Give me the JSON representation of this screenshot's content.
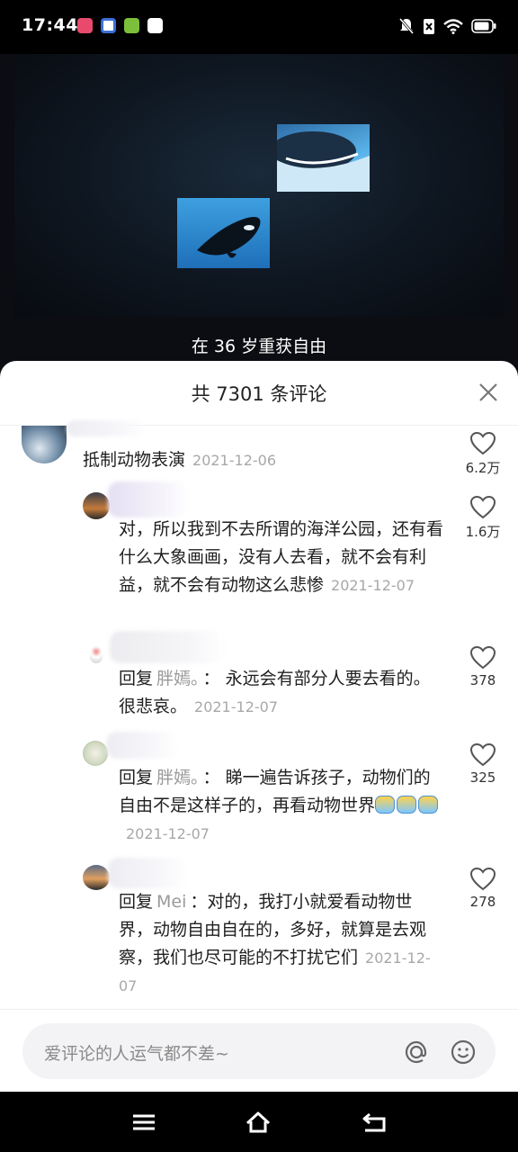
{
  "status_bar": {
    "time": "17:44",
    "app_icons": [
      "weibo-icon",
      "baidu-icon",
      "pear-icon",
      "message-icon"
    ],
    "right_icons": [
      "mute-bell-icon",
      "sim-off-icon",
      "wifi-icon",
      "battery-icon"
    ]
  },
  "video": {
    "subtitle": "在 36 岁重获自由"
  },
  "comments_panel": {
    "title": "共 7301 条评论",
    "comments": [
      {
        "text": "抵制动物表演",
        "date": "2021-12-06",
        "likes": "6.2万"
      },
      {
        "text": "对，所以我到不去所谓的海洋公园，还有看什么大象画画，没有人去看，就不会有利益，就不会有动物这么悲惨",
        "date": "2021-12-07",
        "likes": "1.6万"
      },
      {
        "reply_prefix": "回复",
        "reply_to": "胖嫣。",
        "text": "：  永远会有部分人要去看的。很悲哀。",
        "date": "2021-12-07",
        "likes": "378"
      },
      {
        "reply_prefix": "回复",
        "reply_to": "胖嫣。",
        "text": "：  睇一遍告诉孩子，动物们的自由不是这样子的，再看动物世界",
        "date": "2021-12-07",
        "likes": "325"
      },
      {
        "reply_prefix": "回复",
        "reply_to": "Mei",
        "text": "：对的，我打小就爱看动物世界，动物自由自在的，多好，就算是去观察，我们也尽可能的不打扰它们",
        "date": "2021-12-07",
        "likes": "278"
      }
    ]
  },
  "input": {
    "placeholder": "爱评论的人运气都不差~"
  },
  "colors": {
    "accent_text": "#1f1f1f",
    "muted": "#a8a8a8",
    "sheet_bg": "#ffffff"
  }
}
